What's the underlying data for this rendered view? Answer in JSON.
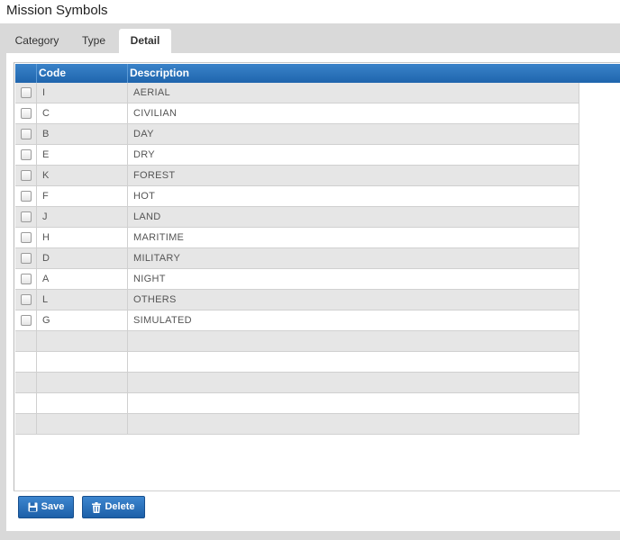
{
  "window": {
    "title": "Mission Symbols"
  },
  "tabs": [
    {
      "label": "Category",
      "active": false
    },
    {
      "label": "Type",
      "active": false
    },
    {
      "label": "Detail",
      "active": true
    }
  ],
  "grid": {
    "columns": {
      "code": "Code",
      "description": "Description"
    },
    "rows": [
      {
        "code": "I",
        "description": "AERIAL"
      },
      {
        "code": "C",
        "description": "CIVILIAN"
      },
      {
        "code": "B",
        "description": "DAY"
      },
      {
        "code": "E",
        "description": "DRY"
      },
      {
        "code": "K",
        "description": "FOREST"
      },
      {
        "code": "F",
        "description": "HOT"
      },
      {
        "code": "J",
        "description": "LAND"
      },
      {
        "code": "H",
        "description": "MARITIME"
      },
      {
        "code": "D",
        "description": "MILITARY"
      },
      {
        "code": "A",
        "description": "NIGHT"
      },
      {
        "code": "L",
        "description": "OTHERS"
      },
      {
        "code": "G",
        "description": "SIMULATED"
      }
    ]
  },
  "buttons": {
    "save_label": "Save",
    "save_icon": "floppy-disk-icon",
    "delete_label": "Delete",
    "delete_icon": "trash-icon"
  },
  "colors": {
    "header_blue": "#1f65ad",
    "button_blue": "#2a72bd",
    "row_alt": "#e6e6e6",
    "frame_gray": "#d9d9d9"
  }
}
